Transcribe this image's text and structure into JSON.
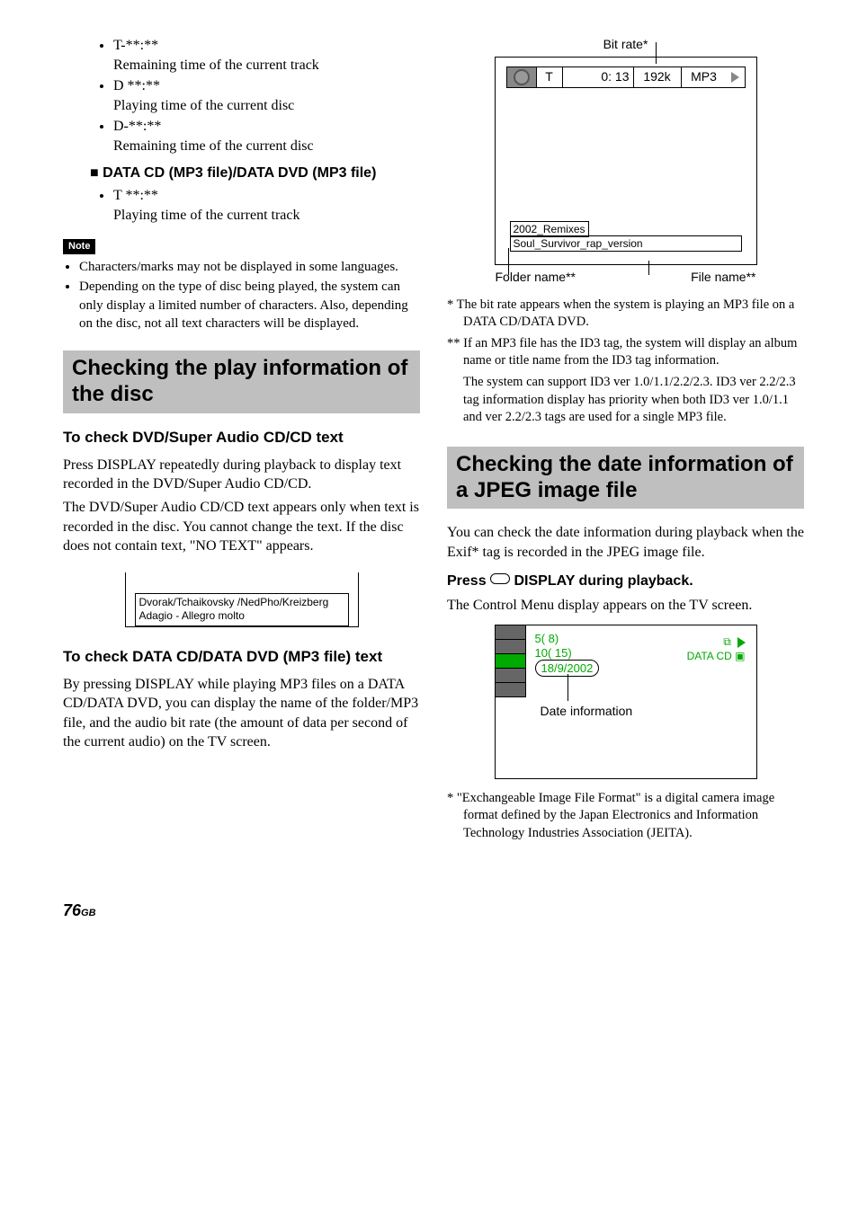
{
  "col1": {
    "bullets1": [
      {
        "code": "T-**:**",
        "desc": "Remaining time of the current track"
      },
      {
        "code": "D **:**",
        "desc": "Playing time of the current disc"
      },
      {
        "code": "D-**:**",
        "desc": "Remaining time of the current disc"
      }
    ],
    "square_heading": "DATA CD (MP3 file)/DATA DVD (MP3 file)",
    "bullets2": [
      {
        "code": "T **:**",
        "desc": "Playing time of the current track"
      }
    ],
    "note_label": "Note",
    "notes": [
      "Characters/marks may not be displayed in some languages.",
      "Depending on the type of disc being played, the system can only display a limited number of characters. Also, depending on the disc, not all text characters will be displayed."
    ],
    "section1": "Checking the play information of the disc",
    "sub1": "To check DVD/Super Audio CD/CD text",
    "para1a": "Press DISPLAY repeatedly during playback to display text recorded in the DVD/Super Audio CD/CD.",
    "para1b": "The DVD/Super Audio CD/CD text appears only when text is recorded in the disc. You cannot change the text. If the disc does not contain text, \"NO TEXT\" appears.",
    "cd_text_line1": "Dvorak/Tchaikovsky /NedPho/Kreizberg",
    "cd_text_line2": "Adagio - Allegro molto",
    "sub2": "To check DATA CD/DATA DVD (MP3 file) text",
    "para2": "By pressing DISPLAY while playing MP3 files on a DATA CD/DATA DVD, you can display the name of the folder/MP3 file, and the audio bit rate (the amount of data per second of the current audio) on the TV screen."
  },
  "col2": {
    "diag": {
      "bitrate_label": "Bit rate*",
      "seg_t": "T",
      "seg_time": "0: 13",
      "seg_rate": "192k",
      "seg_fmt": "MP3",
      "folder": "2002_Remixes",
      "file": "Soul_Survivor_rap_version",
      "folder_label": "Folder name**",
      "file_label": "File name**"
    },
    "footnote1": "*  The bit rate appears when the system is playing an MP3 file on a DATA CD/DATA DVD.",
    "footnote2a": "** If an MP3 file has the ID3 tag, the system will display an album name or title name from the ID3 tag information.",
    "footnote2b": "The system can support ID3 ver 1.0/1.1/2.2/2.3. ID3 ver 2.2/2.3 tag information display has priority when both ID3 ver 1.0/1.1 and ver 2.2/2.3 tags are used for a single MP3 file.",
    "section2": "Checking the date information of a JPEG image file",
    "para_s2": "You can check the date information during playback when the Exif* tag is recorded in the JPEG image file.",
    "press_prefix": "Press ",
    "press_suffix": " DISPLAY during playback.",
    "para_press": "The Control Menu display appears on the TV screen.",
    "cm": {
      "l1": "5(    8)",
      "l2": "10(  15)",
      "l3": "18/9/2002",
      "r1": "DATA CD",
      "date_label": "Date information"
    },
    "footnote3": "*  \"Exchangeable Image File Format\" is a digital camera image format defined by the Japan Electronics and Information Technology Industries Association (JEITA)."
  },
  "page": "76",
  "page_suffix": "GB"
}
